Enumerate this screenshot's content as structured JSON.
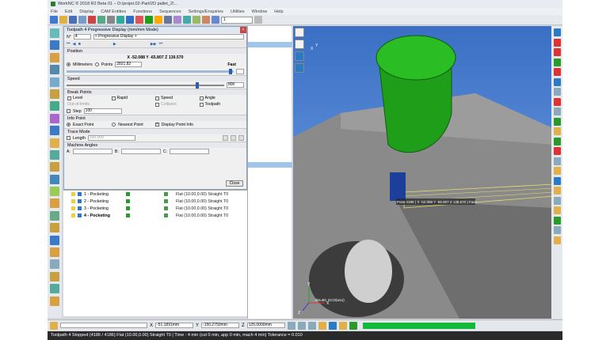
{
  "window": {
    "title": "WorkNC ® 2018 R2 Beta 01 – D:/projet.02-Part/2D pallet_2\\..."
  },
  "menu": [
    "File",
    "Edit",
    "Display",
    "CAM Entities",
    "Functions",
    "Sequences",
    "Settings/Enquiries",
    "Utilities",
    "Window",
    "Help"
  ],
  "toolbar": {
    "combo_value": "1"
  },
  "dialog": {
    "title": "Toolpath 4 Progressive Display (mm/mm Mode)",
    "number_label": "N°",
    "number_value": "4",
    "mode_value": "< Progressive Display >",
    "position_label": "Position",
    "coords": "X -52.088  Y -65.807  Z 139.570",
    "millimeters_label": "Millimeters",
    "points_label": "Points",
    "points_value": "2821.82",
    "fast_label": "Fast",
    "speed_label": "Speed",
    "speed_value": "800",
    "speed_level": 0.82,
    "breakpoints_label": "Break Points",
    "bp": [
      {
        "label": "Level",
        "checked": false,
        "grey": false
      },
      {
        "label": "Rapid",
        "checked": false,
        "grey": false
      },
      {
        "label": "Speed",
        "checked": false,
        "grey": false
      },
      {
        "label": "Angle",
        "checked": false,
        "grey": false
      },
      {
        "label": "Out-of-limits",
        "checked": false,
        "grey": true
      },
      {
        "label": "",
        "checked": false,
        "grey": false
      },
      {
        "label": "Collision",
        "checked": false,
        "grey": true
      },
      {
        "label": "Toolpath",
        "checked": false,
        "grey": false
      }
    ],
    "step_label": "Step",
    "step_value": "100",
    "info_label": "Info Point",
    "exact_label": "Exact Point",
    "nearest_label": "Nearest Point",
    "display_info_label": "Display Point Info",
    "trace_label": "Trace Mode",
    "length_label": "Length",
    "length_value": "200.000",
    "angles_label": "Machine Angles",
    "a_label": "A:",
    "b_label": "B:",
    "c_label": "C:",
    "close_label": "Close"
  },
  "toolpaths": [
    {
      "name": "1 - Pocketing",
      "info": "Flat (10.00,0.00) Straight T0",
      "bold": false
    },
    {
      "name": "2 - Pocketing",
      "info": "Flat (10.00,0.00) Straight T0",
      "bold": false
    },
    {
      "name": "3 - Pocketing",
      "info": "Flat (10.00,0.00) Straight T0",
      "bold": false
    },
    {
      "name": "4 - Pocketing",
      "info": "Flat (10.00,0.00) Straight T0",
      "bold": true
    }
  ],
  "viewport": {
    "point_label": "Point 4186 ( X -52.088 Y -65.807 Z 139.570 ) Fast",
    "axis_x": "X",
    "axis_y": "Y",
    "axis_z": "Z",
    "axis_label": "dmu50_ECO(wcs)",
    "axis_x2": "X",
    "axis_y2": "Y"
  },
  "status": {
    "x_label": "X",
    "x_value": "-51.1891mm",
    "y_label": "Y",
    "y_value": "-150.2750mm",
    "z_label": "Z",
    "z_value": "125.0000mm"
  },
  "bottom_text": "Toolpath 4 Stopped (4186 / 4186) Flat (10.00,0.00) Straight T0 | Time : 4 min (cut 0 min, app 0 min, mach 4 min) Tolerance = 0.010",
  "colors": {
    "tool_green": "#1f9e1a",
    "tool_blue": "#1b3f9a",
    "accent": "#a9cdee",
    "progress_green": "#12b93b"
  }
}
